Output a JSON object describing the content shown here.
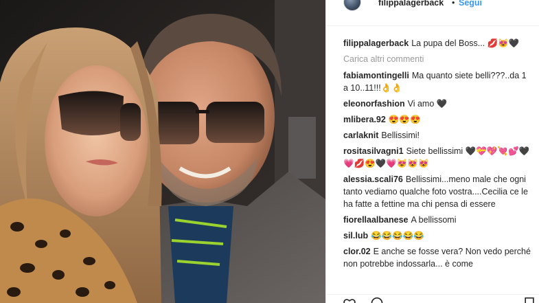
{
  "header": {
    "username": "filippalagerback",
    "dot": "•",
    "follow_label": "Segui",
    "avatar_icon": "profile-avatar"
  },
  "caption": {
    "username": "filippalagerback",
    "text": "La pupa del Boss... 💋😻🖤"
  },
  "load_more_label": "Carica altri commenti",
  "comments": [
    {
      "username": "fabiamontingelli",
      "text": "Ma quanto siete belli???..da 1 a 10..11!!!👌👌"
    },
    {
      "username": "eleonorfashion",
      "text": "Vi amo 🖤"
    },
    {
      "username": "mlibera.92",
      "text": "😍😍😍"
    },
    {
      "username": "carlaknit",
      "text": "Bellissimi!"
    },
    {
      "username": "rositasilvagni1",
      "text": "Siete bellissimi 🖤💝💖💘💕🖤💗💋😍🖤💗😻😻😻"
    },
    {
      "username": "alessia.scali76",
      "text": "Bellissimi...meno male che ogni tanto vediamo qualche foto vostra....Cecilia ce le ha fatte a fettine ma chi pensa di essere"
    },
    {
      "username": "fiorellaalbanese",
      "text": "A bellissomi"
    },
    {
      "username": "sil.lub",
      "text": "😂😂😂😂😂"
    },
    {
      "username": "clor.02",
      "text": "E anche se fosse vera? Non vedo perché non potrebbe indossarla... è come"
    }
  ],
  "actions": {
    "like_icon": "heart-icon",
    "comment_icon": "comment-icon",
    "save_icon": "bookmark-icon"
  },
  "colors": {
    "link": "#3897f0",
    "text": "#262626",
    "muted": "#999999",
    "border": "#efefef"
  }
}
